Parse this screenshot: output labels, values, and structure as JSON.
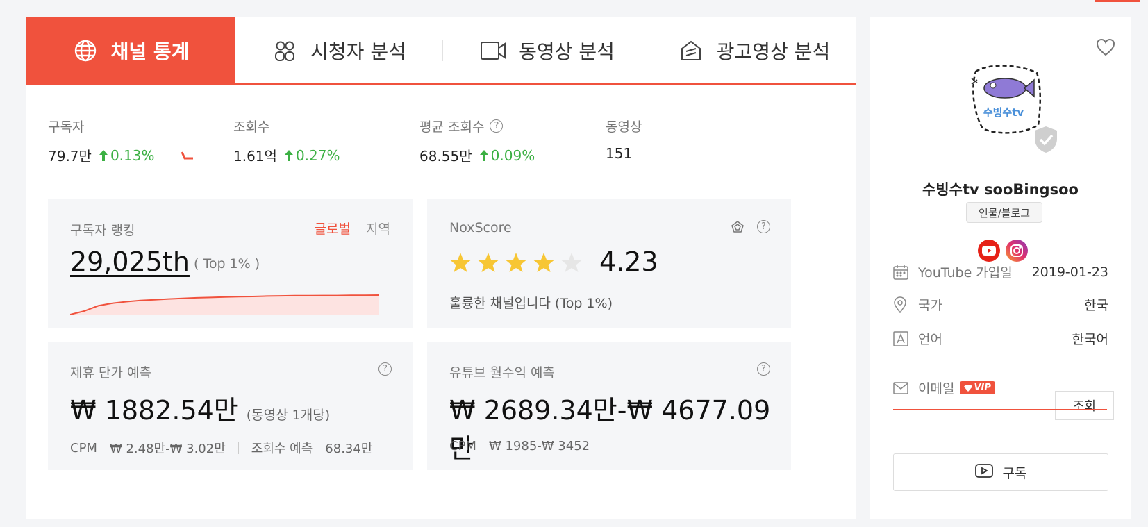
{
  "colors": {
    "accent": "#f0523d",
    "up": "#3cb043",
    "star": "#f7c634",
    "star_off": "#e6e6e6"
  },
  "tabs": [
    {
      "label": "채널 통계",
      "icon": "globe-icon",
      "active": true
    },
    {
      "label": "시청자 분석",
      "icon": "audience-icon",
      "active": false
    },
    {
      "label": "동영상 분석",
      "icon": "video-camera-icon",
      "active": false
    },
    {
      "label": "광고영상 분석",
      "icon": "ad-video-icon",
      "active": false
    }
  ],
  "stats": {
    "subscribers": {
      "label": "구독자",
      "value": "79.7만",
      "change": "0.13%"
    },
    "views": {
      "label": "조회수",
      "value": "1.61억",
      "change": "0.27%"
    },
    "avg_views": {
      "label": "평균 조회수",
      "value": "68.55만",
      "change": "0.09%"
    },
    "videos": {
      "label": "동영상",
      "value": "151"
    }
  },
  "ranking": {
    "title": "구독자 랭킹",
    "tab_global": "글로벌",
    "tab_region": "지역",
    "rank": "29,025th",
    "top": "( Top 1% )",
    "trend": [
      0.0,
      0.18,
      0.45,
      0.58,
      0.66,
      0.72,
      0.76,
      0.8,
      0.83,
      0.86,
      0.88,
      0.9,
      0.92,
      0.93,
      0.95,
      0.96,
      0.97,
      0.97,
      0.98,
      0.98,
      0.99,
      0.99,
      1.0
    ]
  },
  "noxscore": {
    "title": "NoxScore",
    "score": "4.23",
    "stars_filled": 4,
    "stars_total": 5,
    "description": "훌륭한 채널입니다 (Top 1%)"
  },
  "affiliate": {
    "title": "제휴 단가 예측",
    "amount": "₩ 1882.54만",
    "amount_note": "(동영상 1개당)",
    "cpm_label": "CPM",
    "cpm_value": "₩ 2.48만-₩ 3.02만",
    "views_label": "조회수 예측",
    "views_value": "68.34만"
  },
  "monthly": {
    "title": "유튜브 월수익 예측",
    "amount": "₩ 2689.34만-₩ 4677.09만",
    "cpm_label": "CPM",
    "cpm_value": "₩ 1985-₩ 3452"
  },
  "channel": {
    "name": "수빙수tv sooBingsoo",
    "category": "인물/블로그",
    "avatar_text": "수빙수tv",
    "joined_label": "YouTube 가입일",
    "joined_value": "2019-01-23",
    "country_label": "국가",
    "country_value": "한국",
    "language_label": "언어",
    "language_value": "한국어",
    "email_label": "이메일",
    "vip_label": "VIP",
    "lookup_button": "조회",
    "subscribe_button": "구독"
  }
}
